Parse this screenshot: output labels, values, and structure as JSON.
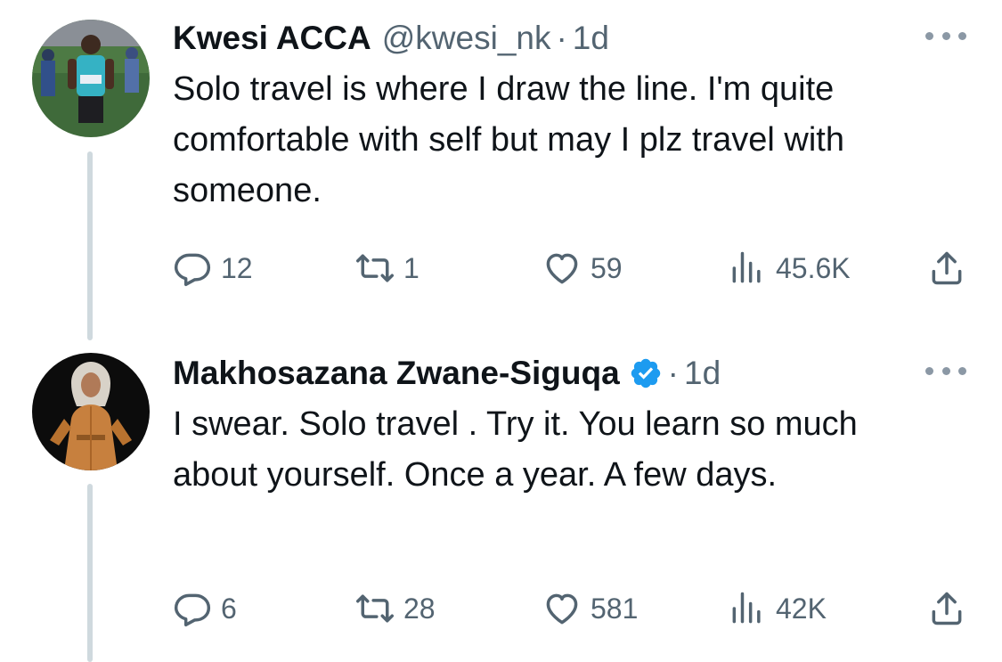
{
  "tweets": [
    {
      "author_name": "Kwesi ACCA",
      "handle": "@kwesi_nk",
      "separator": "·",
      "time": "1d",
      "verified": false,
      "text": "Solo travel is where I draw the line. I'm quite comfortable with self but may I plz travel with someone.",
      "replies": "12",
      "retweets": "1",
      "likes": "59",
      "views": "45.6K",
      "avatar_icon": "runner-photo-avatar"
    },
    {
      "author_name": "Makhosazana Zwane-Siguqa",
      "handle": "",
      "separator": "·",
      "time": "1d",
      "verified": true,
      "text": "I swear. Solo travel . Try it. You learn so much about yourself.  Once a year. A few days.",
      "replies": "6",
      "retweets": "28",
      "likes": "581",
      "views": "42K",
      "avatar_icon": "woman-portrait-avatar"
    }
  ],
  "colors": {
    "text_primary": "#0f1419",
    "text_secondary": "#536471",
    "verified_blue": "#1d9bf0",
    "thread_line": "#cfd9de"
  },
  "icons": [
    "reply-icon",
    "retweet-icon",
    "like-icon",
    "views-icon",
    "share-icon",
    "more-icon",
    "verified-badge-icon"
  ]
}
